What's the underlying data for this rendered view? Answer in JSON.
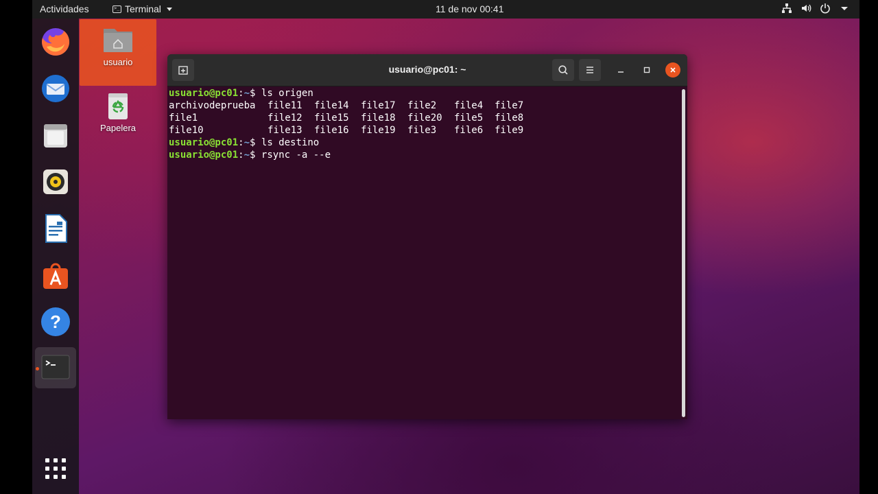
{
  "topbar": {
    "activities": "Actividades",
    "app_name": "Terminal",
    "clock": "11 de nov  00:41",
    "tray_icons": [
      "network-icon",
      "volume-icon",
      "power-icon",
      "chevron-down-icon"
    ]
  },
  "dock": {
    "items": [
      {
        "name": "firefox-icon"
      },
      {
        "name": "thunderbird-icon"
      },
      {
        "name": "files-icon"
      },
      {
        "name": "rhythmbox-icon"
      },
      {
        "name": "libreoffice-writer-icon"
      },
      {
        "name": "software-center-icon"
      },
      {
        "name": "help-icon"
      },
      {
        "name": "terminal-icon",
        "active": true
      },
      {
        "name": "show-apps-icon"
      }
    ]
  },
  "desktop": {
    "icons": [
      {
        "label": "usuario",
        "icon": "home-folder-icon"
      },
      {
        "label": "Papelera",
        "icon": "trash-icon"
      }
    ]
  },
  "terminal": {
    "title": "usuario@pc01: ~",
    "prompt_user": "usuario@pc01",
    "prompt_sep": ":",
    "prompt_path": "~",
    "prompt_dollar": "$ ",
    "commands": [
      "ls origen",
      "ls destino",
      "rsync -a --e"
    ],
    "ls_output": [
      [
        "archivodeprueba",
        "file11",
        "file14",
        "file17",
        "file2",
        "file4",
        "file7"
      ],
      [
        "file1",
        "file12",
        "file15",
        "file18",
        "file20",
        "file5",
        "file8"
      ],
      [
        "file10",
        "file13",
        "file16",
        "file19",
        "file3",
        "file6",
        "file9"
      ]
    ]
  },
  "colors": {
    "accent": "#e95420",
    "terminal_bg": "#300a24",
    "prompt_user": "#8ae234",
    "prompt_path": "#729fcf"
  }
}
